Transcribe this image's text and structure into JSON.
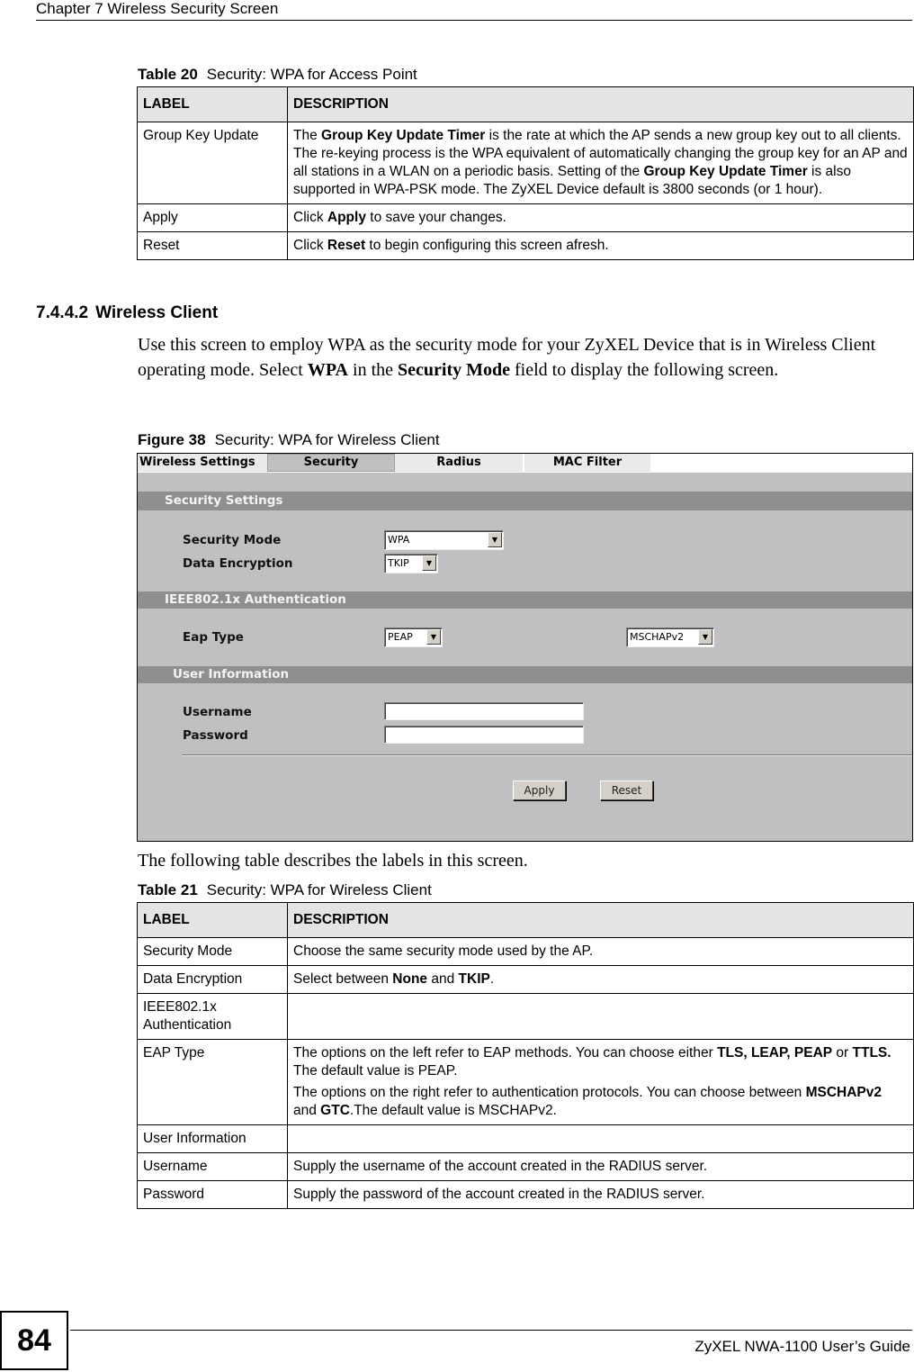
{
  "header": {
    "chapter_title": "Chapter 7 Wireless Security Screen"
  },
  "table20": {
    "caption_label": "Table 20",
    "caption_title": "Security: WPA for Access Point",
    "headers": [
      "LABEL",
      "DESCRIPTION"
    ],
    "rows": [
      {
        "label": "Group Key Update",
        "desc": [
          {
            "t": "The "
          },
          {
            "b": "Group Key Update Timer"
          },
          {
            "t": " is the rate at which the AP sends a new group key out to all clients. The re-keying process is the WPA equivalent of automatically changing the group key for an AP and all stations in a WLAN on a periodic basis. Setting of the "
          },
          {
            "b": "Group Key Update Timer"
          },
          {
            "t": " is also supported in WPA-PSK mode. The ZyXEL Device default is 3800 seconds (or 1 hour)."
          }
        ]
      },
      {
        "label": "Apply",
        "desc": [
          {
            "t": "Click "
          },
          {
            "b": "Apply"
          },
          {
            "t": " to save your changes."
          }
        ]
      },
      {
        "label": "Reset",
        "desc": [
          {
            "t": "Click "
          },
          {
            "b": "Reset"
          },
          {
            "t": " to begin configuring this screen afresh."
          }
        ]
      }
    ]
  },
  "section": {
    "number": "7.4.4.2",
    "title": "Wireless Client",
    "intro": [
      {
        "t": "Use this screen to employ WPA as the security mode for your ZyXEL Device that is in Wireless Client operating mode. Select "
      },
      {
        "b": "WPA"
      },
      {
        "t": " in the "
      },
      {
        "b": "Security Mode"
      },
      {
        "t": " field to display the following screen."
      }
    ]
  },
  "figure38": {
    "caption_label": "Figure 38",
    "caption_title": "Security: WPA for Wireless Client",
    "tabs": [
      "Wireless Settings",
      "Security",
      "Radius",
      "MAC Filter"
    ],
    "active_tab": "Security",
    "sections": {
      "security_settings": "Security Settings",
      "ieee": "IEEE802.1x Authentication",
      "user_info": "User Information"
    },
    "fields": {
      "security_mode_label": "Security Mode",
      "security_mode_value": "WPA",
      "data_encryption_label": "Data Encryption",
      "data_encryption_value": "TKIP",
      "eap_type_label": "Eap Type",
      "eap_method_value": "PEAP",
      "eap_protocol_value": "MSCHAPv2",
      "username_label": "Username",
      "username_value": "",
      "password_label": "Password",
      "password_value": ""
    },
    "buttons": {
      "apply": "Apply",
      "reset": "Reset"
    },
    "icons": {
      "dropdown_arrow": "▼"
    }
  },
  "follow_text": "The following table describes the labels in this screen.",
  "table21": {
    "caption_label": "Table 21",
    "caption_title": "Security: WPA for Wireless Client",
    "headers": [
      "LABEL",
      "DESCRIPTION"
    ],
    "rows": [
      {
        "label": "Security Mode",
        "desc": [
          [
            {
              "t": "Choose the same security mode used by the AP."
            }
          ]
        ]
      },
      {
        "label": "Data Encryption",
        "desc": [
          [
            {
              "t": "Select between "
            },
            {
              "b": "None"
            },
            {
              "t": " and "
            },
            {
              "b": "TKIP"
            },
            {
              "t": "."
            }
          ]
        ]
      },
      {
        "label": "IEEE802.1x Authentication",
        "desc": [
          []
        ]
      },
      {
        "label": "EAP Type",
        "desc": [
          [
            {
              "t": "The options on the left refer to EAP methods. You can choose either "
            },
            {
              "b": "TLS, LEAP, PEAP"
            },
            {
              "t": " or "
            },
            {
              "b": "TTLS."
            },
            {
              "t": " The default value is PEAP."
            }
          ],
          [
            {
              "t": "The options on the right refer to authentication protocols. You can choose between "
            },
            {
              "b": "MSCHAPv2"
            },
            {
              "t": " and "
            },
            {
              "b": "GTC"
            },
            {
              "t": ".The default value is MSCHAPv2."
            }
          ]
        ]
      },
      {
        "label": "User Information",
        "desc": [
          []
        ]
      },
      {
        "label": "Username",
        "desc": [
          [
            {
              "t": "Supply the username of the account created in the RADIUS server."
            }
          ]
        ]
      },
      {
        "label": "Password",
        "desc": [
          [
            {
              "t": "Supply the password of the account created in the RADIUS server."
            }
          ]
        ]
      }
    ]
  },
  "footer": {
    "page_number": "84",
    "guide_title": "ZyXEL NWA-1100 User’s Guide"
  }
}
